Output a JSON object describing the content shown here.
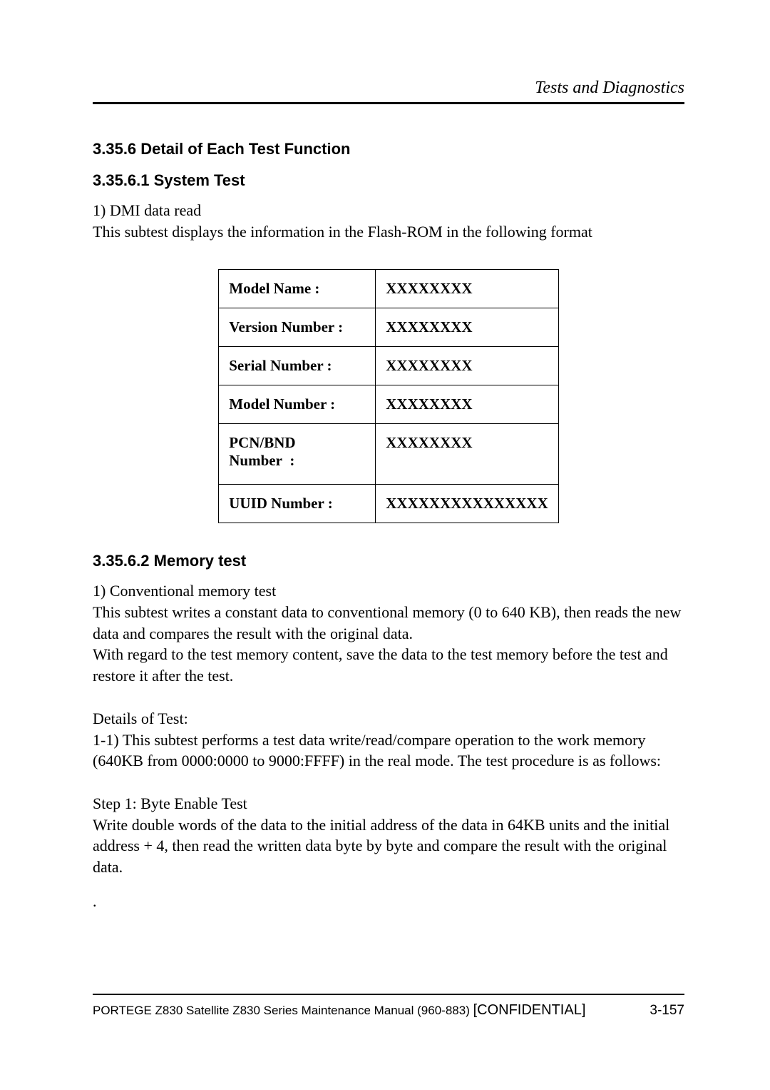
{
  "header": {
    "chapter_title": "Tests and Diagnostics"
  },
  "section_3_35_6": {
    "heading": "3.35.6  Detail of Each Test Function"
  },
  "section_3_35_6_1": {
    "heading": "3.35.6.1   System Test",
    "item1_title": "1) DMI data read",
    "item1_desc": "This subtest displays the information in the Flash-ROM in the following format"
  },
  "dmi_table": {
    "rows": [
      {
        "label": "Model Name  :",
        "value": "XXXXXXXX"
      },
      {
        "label": "Version Number  :",
        "value": "XXXXXXXX"
      },
      {
        "label": "Serial Number  :",
        "value": "XXXXXXXX"
      },
      {
        "label": "Model Number  :",
        "value": "XXXXXXXX"
      },
      {
        "label": "PCN/BND Number  :",
        "value": "XXXXXXXX"
      },
      {
        "label": "UUID Number  :",
        "value": "XXXXXXXXXXXXXXX"
      }
    ]
  },
  "section_3_35_6_2": {
    "heading": "3.35.6.2    Memory test",
    "item1_title": "1) Conventional memory test",
    "item1_p1": "This subtest writes a constant data to conventional memory (0 to 640 KB), then reads the new data and compares the result with the original data.",
    "item1_p2": "With regard to the test memory content, save the data to the test memory before the test and restore it after the test.",
    "details_heading": "Details of Test:",
    "details_p1": "1-1) This subtest performs a test data write/read/compare operation to the work memory (640KB from 0000:0000 to 9000:FFFF) in the real mode. The test procedure is as follows:",
    "step1_heading": "Step 1: Byte Enable Test",
    "step1_p1": "Write double words of the data to the initial address of the data in 64KB units and the initial address + 4, then read the written data byte by byte and compare the result with the original data.",
    "trailing_dot": "."
  },
  "footer": {
    "manual": "PORTEGE Z830 Satellite Z830 Series Maintenance Manual (960-883) ",
    "confidential": "[CONFIDENTIAL]",
    "page": "3-157"
  }
}
